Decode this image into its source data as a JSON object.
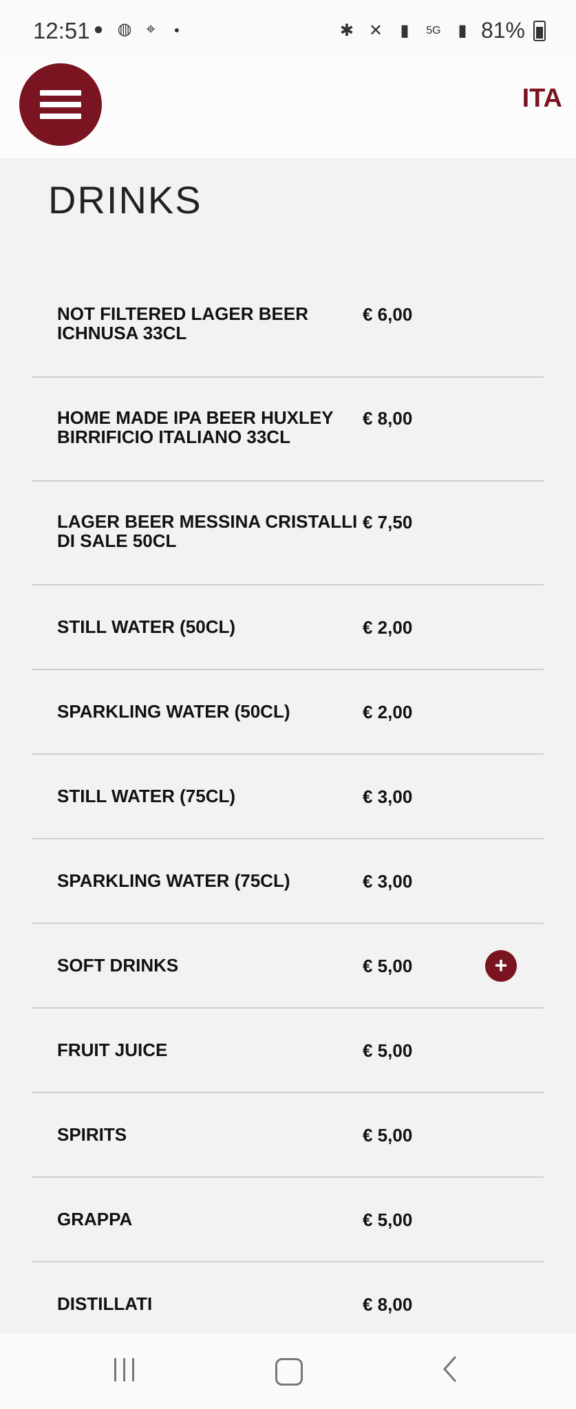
{
  "status": {
    "time": "12:51",
    "battery": "81%",
    "left_icons": [
      "chat-icon",
      "globe-icon",
      "maps-icon",
      "dot-icon"
    ],
    "right_icons": [
      "bluetooth-icon",
      "mute-icon",
      "signal-r-icon",
      "5g-icon",
      "signal-icon",
      "battery-icon"
    ]
  },
  "header": {
    "language": "ITA"
  },
  "section": {
    "title": "DRINKS"
  },
  "items": [
    {
      "name": "NOT FILTERED LAGER BEER ICHNUSA 33CL",
      "price": "€ 6,00"
    },
    {
      "name": "HOME MADE IPA BEER HUXLEY BIRRIFICIO ITALIANO 33CL",
      "price": "€ 8,00"
    },
    {
      "name": "LAGER BEER MESSINA CRISTALLI DI SALE 50CL",
      "price": "€ 7,50"
    },
    {
      "name": "STILL WATER (50CL)",
      "price": "€ 2,00"
    },
    {
      "name": "SPARKLING WATER (50CL)",
      "price": "€ 2,00"
    },
    {
      "name": "STILL WATER (75CL)",
      "price": "€ 3,00"
    },
    {
      "name": "SPARKLING WATER (75CL)",
      "price": "€ 3,00"
    },
    {
      "name": "SOFT DRINKS",
      "price": "€ 5,00",
      "expand_label": "+"
    },
    {
      "name": "FRUIT JUICE",
      "price": "€ 5,00"
    },
    {
      "name": "SPIRITS",
      "price": "€ 5,00"
    },
    {
      "name": "GRAPPA",
      "price": "€ 5,00"
    },
    {
      "name": "DISTILLATI",
      "price": "€ 8,00"
    }
  ],
  "colors": {
    "accent": "#7a1420",
    "background": "#f2f2f2",
    "divider": "#cfcfcf"
  }
}
